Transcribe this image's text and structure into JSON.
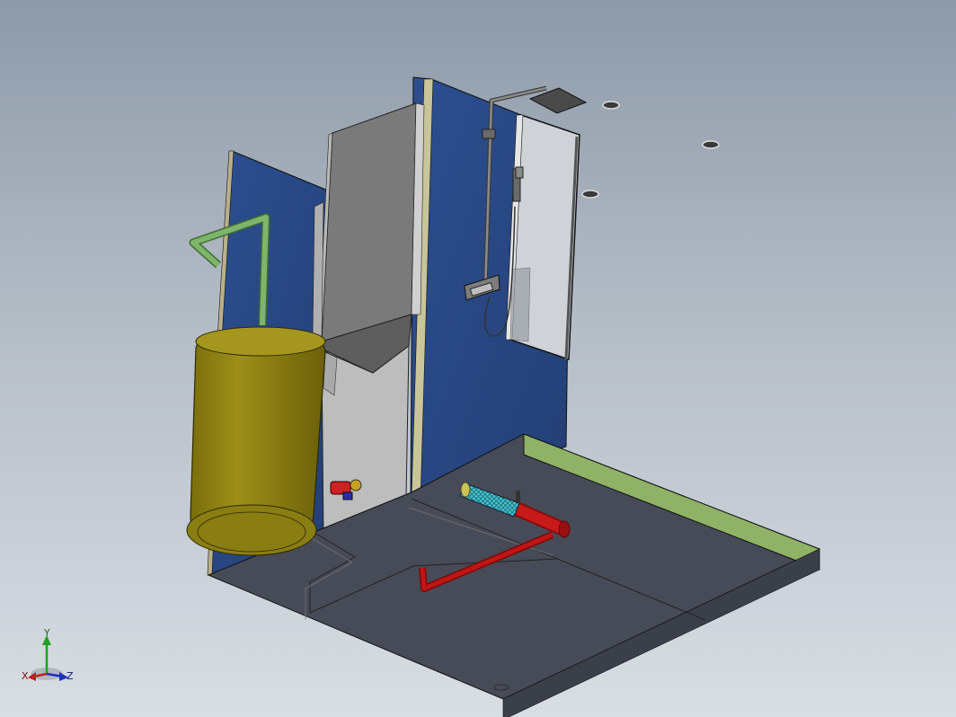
{
  "viewport": {
    "background_top": "#8e9aa9",
    "background_bottom": "#d9dee4"
  },
  "model": {
    "parts": [
      "floor-slab",
      "back-wall",
      "left-wall",
      "partition-block",
      "glass-shower-screen",
      "shower-column",
      "rain-shower-head",
      "hand-shower",
      "mixer-valve",
      "water-heater-tank",
      "green-inlet-pipe",
      "red-drain-pipe",
      "cyan-filter",
      "wall-valve",
      "ceiling-downlights"
    ],
    "colors": {
      "wall": "#2a4a86",
      "floor": "#474b57",
      "partition": "#7a7a7a",
      "tank": "#8a7d12",
      "green_pipe": "#7fb56a",
      "red_pipe": "#c01515",
      "filter": "#48c6d2",
      "floor_edge": "#8fb267"
    }
  },
  "triad": {
    "x_label": "X",
    "y_label": "Y",
    "z_label": "Z",
    "x_color": "#c02020",
    "y_color": "#20a020",
    "z_color": "#2030c0"
  }
}
